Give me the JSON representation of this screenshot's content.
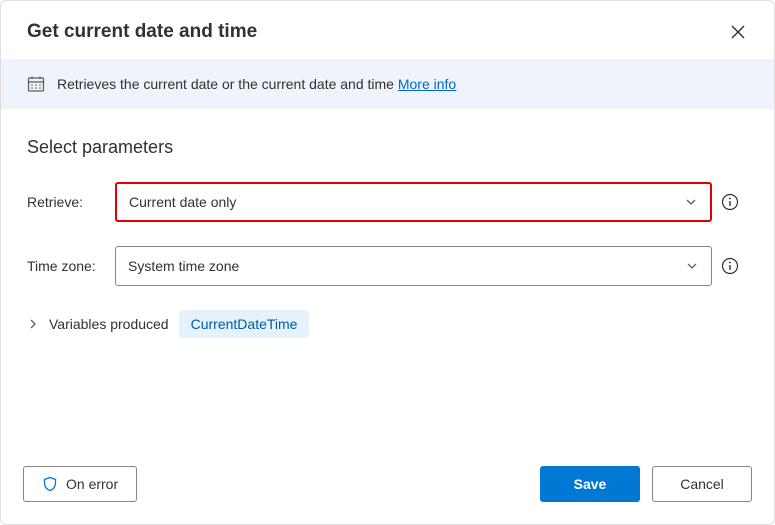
{
  "dialog": {
    "title": "Get current date and time"
  },
  "banner": {
    "text": "Retrieves the current date or the current date and time ",
    "link_label": "More info"
  },
  "section": {
    "title": "Select parameters"
  },
  "params": {
    "retrieve_label": "Retrieve:",
    "retrieve_value": "Current date only",
    "timezone_label": "Time zone:",
    "timezone_value": "System time zone"
  },
  "variables": {
    "label": "Variables produced",
    "chip": "CurrentDateTime"
  },
  "footer": {
    "on_error": "On error",
    "save": "Save",
    "cancel": "Cancel"
  }
}
